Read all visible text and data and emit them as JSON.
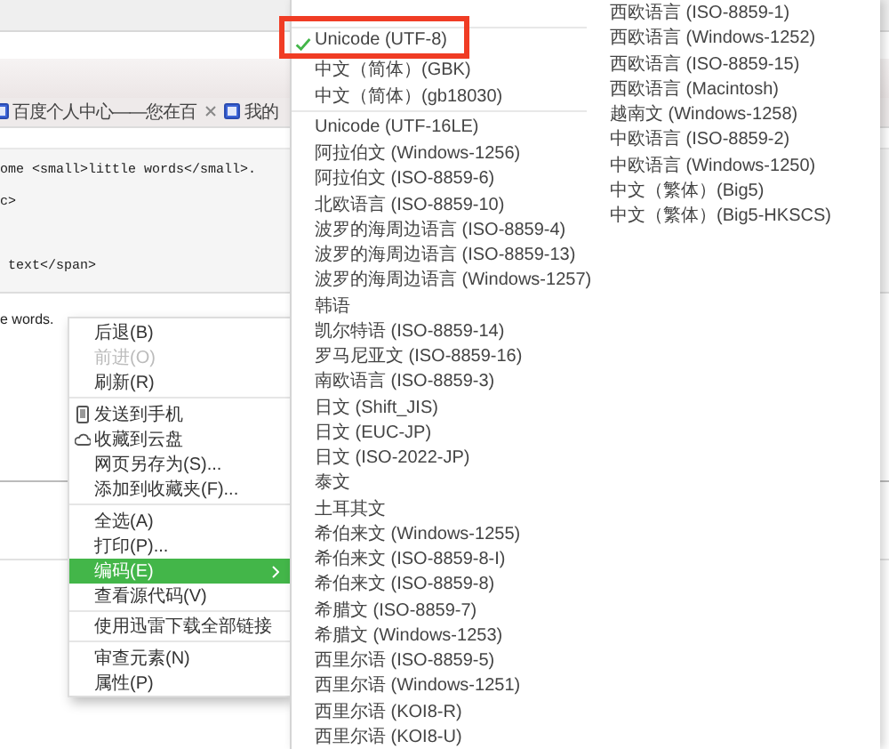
{
  "browser": {
    "tabs": [
      {
        "label": "百度个人中心——您在百",
        "closable": true
      },
      {
        "label": "我的",
        "closable": false
      }
    ],
    "code_lines": [
      {
        "kind": "text",
        "text": "ome <small>little words</small>."
      },
      {
        "kind": "text",
        "text": "c>"
      },
      {
        "kind": "blank"
      },
      {
        "kind": "text",
        "text": " text</span>"
      }
    ],
    "preview_text": "e words."
  },
  "context_menu": {
    "items": [
      {
        "kind": "item",
        "label": "后退(B)",
        "disabled": false,
        "selected": false,
        "has_submenu": false
      },
      {
        "kind": "item",
        "label": "前进(O)",
        "disabled": true,
        "selected": false,
        "has_submenu": false
      },
      {
        "kind": "item",
        "label": "刷新(R)",
        "disabled": false,
        "selected": false,
        "has_submenu": false
      },
      {
        "kind": "separator"
      },
      {
        "kind": "phone",
        "label": "发送到手机",
        "disabled": false,
        "selected": false,
        "has_submenu": false
      },
      {
        "kind": "cloud",
        "label": "收藏到云盘",
        "disabled": false,
        "selected": false,
        "has_submenu": false
      },
      {
        "kind": "item",
        "label": "网页另存为(S)...",
        "disabled": false,
        "selected": false,
        "has_submenu": false
      },
      {
        "kind": "item",
        "label": "添加到收藏夹(F)...",
        "disabled": false,
        "selected": false,
        "has_submenu": false
      },
      {
        "kind": "separator"
      },
      {
        "kind": "item",
        "label": "全选(A)",
        "disabled": false,
        "selected": false,
        "has_submenu": false
      },
      {
        "kind": "item",
        "label": "打印(P)...",
        "disabled": false,
        "selected": false,
        "has_submenu": false
      },
      {
        "kind": "item",
        "label": "编码(E)",
        "disabled": false,
        "selected": true,
        "has_submenu": true
      },
      {
        "kind": "item",
        "label": "查看源代码(V)",
        "disabled": false,
        "selected": false,
        "has_submenu": false
      },
      {
        "kind": "separator"
      },
      {
        "kind": "item",
        "label": "使用迅雷下载全部链接",
        "disabled": false,
        "selected": false,
        "has_submenu": false
      },
      {
        "kind": "separator"
      },
      {
        "kind": "item",
        "label": "审查元素(N)",
        "disabled": false,
        "selected": false,
        "has_submenu": false
      },
      {
        "kind": "item",
        "label": "属性(P)",
        "disabled": false,
        "selected": false,
        "has_submenu": false
      }
    ]
  },
  "encoding_menu": {
    "columns": [
      {
        "items": [
          {
            "kind": "separator"
          },
          {
            "kind": "item",
            "label": "Unicode (UTF-8)",
            "checked": true,
            "highlighted": true
          },
          {
            "kind": "item",
            "label": "中文（简体）(GBK)",
            "checked": false,
            "highlighted": false
          },
          {
            "kind": "item",
            "label": "中文（简体）(gb18030)",
            "checked": false,
            "highlighted": false
          },
          {
            "kind": "separator"
          },
          {
            "kind": "item",
            "label": "Unicode (UTF-16LE)",
            "checked": false,
            "highlighted": false
          },
          {
            "kind": "item",
            "label": "阿拉伯文 (Windows-1256)",
            "checked": false,
            "highlighted": false
          },
          {
            "kind": "item",
            "label": "阿拉伯文 (ISO-8859-6)",
            "checked": false,
            "highlighted": false
          },
          {
            "kind": "item",
            "label": "北欧语言 (ISO-8859-10)",
            "checked": false,
            "highlighted": false
          },
          {
            "kind": "item",
            "label": "波罗的海周边语言 (ISO-8859-4)",
            "checked": false,
            "highlighted": false
          },
          {
            "kind": "item",
            "label": "波罗的海周边语言 (ISO-8859-13)",
            "checked": false,
            "highlighted": false
          },
          {
            "kind": "item",
            "label": "波罗的海周边语言 (Windows-1257)",
            "checked": false,
            "highlighted": false
          },
          {
            "kind": "item",
            "label": "韩语",
            "checked": false,
            "highlighted": false
          },
          {
            "kind": "item",
            "label": "凯尔特语 (ISO-8859-14)",
            "checked": false,
            "highlighted": false
          },
          {
            "kind": "item",
            "label": "罗马尼亚文 (ISO-8859-16)",
            "checked": false,
            "highlighted": false
          },
          {
            "kind": "item",
            "label": "南欧语言 (ISO-8859-3)",
            "checked": false,
            "highlighted": false
          },
          {
            "kind": "item",
            "label": "日文 (Shift_JIS)",
            "checked": false,
            "highlighted": false
          },
          {
            "kind": "item",
            "label": "日文 (EUC-JP)",
            "checked": false,
            "highlighted": false
          },
          {
            "kind": "item",
            "label": "日文 (ISO-2022-JP)",
            "checked": false,
            "highlighted": false
          },
          {
            "kind": "item",
            "label": "泰文",
            "checked": false,
            "highlighted": false
          },
          {
            "kind": "item",
            "label": "土耳其文",
            "checked": false,
            "highlighted": false
          },
          {
            "kind": "item",
            "label": "希伯来文 (Windows-1255)",
            "checked": false,
            "highlighted": false
          },
          {
            "kind": "item",
            "label": "希伯来文 (ISO-8859-8-I)",
            "checked": false,
            "highlighted": false
          },
          {
            "kind": "item",
            "label": "希伯来文 (ISO-8859-8)",
            "checked": false,
            "highlighted": false
          },
          {
            "kind": "item",
            "label": "希腊文 (ISO-8859-7)",
            "checked": false,
            "highlighted": false
          },
          {
            "kind": "item",
            "label": "希腊文 (Windows-1253)",
            "checked": false,
            "highlighted": false
          },
          {
            "kind": "item",
            "label": "西里尔语 (ISO-8859-5)",
            "checked": false,
            "highlighted": false
          },
          {
            "kind": "item",
            "label": "西里尔语 (Windows-1251)",
            "checked": false,
            "highlighted": false
          },
          {
            "kind": "item",
            "label": "西里尔语 (KOI8-R)",
            "checked": false,
            "highlighted": false
          },
          {
            "kind": "item",
            "label": "西里尔语 (KOI8-U)",
            "checked": false,
            "highlighted": false
          }
        ]
      },
      {
        "items": [
          {
            "kind": "item",
            "label": "西欧语言 (ISO-8859-1)",
            "checked": false,
            "highlighted": false
          },
          {
            "kind": "item",
            "label": "西欧语言 (Windows-1252)",
            "checked": false,
            "highlighted": false
          },
          {
            "kind": "item",
            "label": "西欧语言 (ISO-8859-15)",
            "checked": false,
            "highlighted": false
          },
          {
            "kind": "item",
            "label": "西欧语言 (Macintosh)",
            "checked": false,
            "highlighted": false
          },
          {
            "kind": "item",
            "label": "越南文 (Windows-1258)",
            "checked": false,
            "highlighted": false
          },
          {
            "kind": "item",
            "label": "中欧语言 (ISO-8859-2)",
            "checked": false,
            "highlighted": false
          },
          {
            "kind": "item",
            "label": "中欧语言 (Windows-1250)",
            "checked": false,
            "highlighted": false
          },
          {
            "kind": "item",
            "label": "中文（繁体）(Big5)",
            "checked": false,
            "highlighted": false
          },
          {
            "kind": "item",
            "label": "中文（繁体）(Big5-HKSCS)",
            "checked": false,
            "highlighted": false
          }
        ]
      }
    ]
  }
}
